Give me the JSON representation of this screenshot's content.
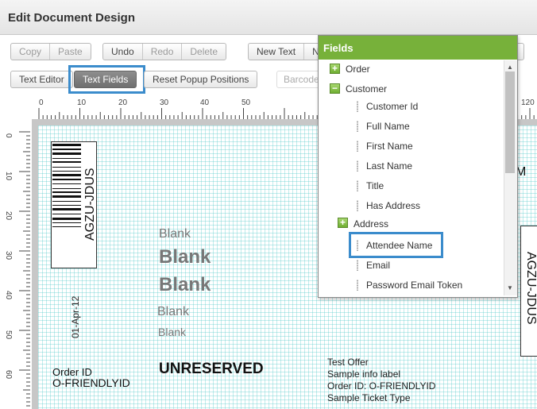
{
  "window": {
    "title": "Edit Document Design"
  },
  "toolbar1": {
    "copy": "Copy",
    "paste": "Paste",
    "undo": "Undo",
    "redo": "Redo",
    "delete": "Delete",
    "new_text": "New Text",
    "new_text_trunc": "N"
  },
  "toolbar2": {
    "text_editor": "Text Editor",
    "text_fields": "Text Fields",
    "reset_popup": "Reset Popup Positions",
    "barcode": "Barcode"
  },
  "ruler_top_labels": [
    "0",
    "10",
    "20",
    "30",
    "40",
    "50",
    "120"
  ],
  "ruler_left_labels": [
    "0",
    "10",
    "20",
    "30",
    "40",
    "50",
    "60"
  ],
  "canvas": {
    "barcode_text": "AGZU-JDUS",
    "barcode_text_right": "AGZU-JDUS",
    "date": "01-Apr-12",
    "order_id_label": "Order ID",
    "order_id_value": "O-FRIENDLYID",
    "blank1": "Blank",
    "blank2": "Blank",
    "blank3": "Blank",
    "blank4": "Blank",
    "blank5": "Blank",
    "unreserved": "UNRESERVED",
    "right_m": "M",
    "info_line1": "Test Offer",
    "info_line2": "Sample info label",
    "info_line3": "Order ID: O-FRIENDLYID",
    "info_line4": "Sample Ticket Type"
  },
  "fields_popup": {
    "title": "Fields",
    "items": [
      {
        "label": "Order",
        "type": "expand"
      },
      {
        "label": "Customer",
        "type": "collapse"
      },
      {
        "label": "Customer Id",
        "type": "field"
      },
      {
        "label": "Full Name",
        "type": "field"
      },
      {
        "label": "First Name",
        "type": "field"
      },
      {
        "label": "Last Name",
        "type": "field"
      },
      {
        "label": "Title",
        "type": "field"
      },
      {
        "label": "Has Address",
        "type": "field"
      },
      {
        "label": "Address",
        "type": "expand"
      },
      {
        "label": "Attendee Name",
        "type": "field"
      },
      {
        "label": "Email",
        "type": "field"
      },
      {
        "label": "Password Email Token",
        "type": "field"
      }
    ]
  },
  "colors": {
    "accent_green": "#77b13a",
    "highlight_blue": "#3b8ccc",
    "grid": "#50c8c8"
  }
}
